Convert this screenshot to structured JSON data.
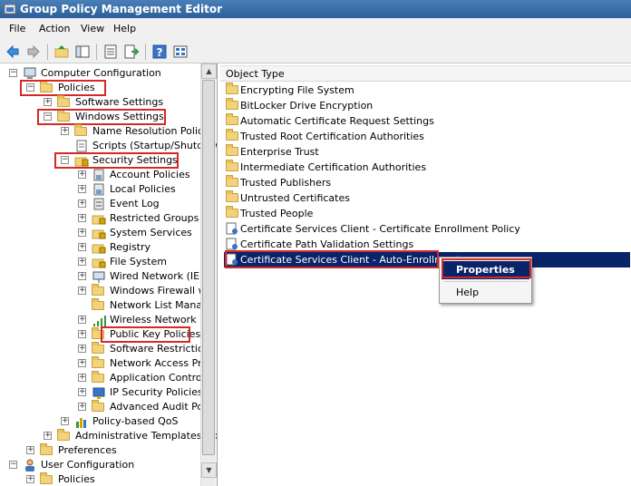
{
  "window": {
    "title": "Group Policy Management Editor"
  },
  "menu": {
    "file": "File",
    "action": "Action",
    "view": "View",
    "help": "Help"
  },
  "toolbar": {
    "icons": [
      "back-arrow-icon",
      "forward-arrow-icon",
      "up-folder-icon",
      "show-hide-tree-icon",
      "properties-icon",
      "export-list-icon",
      "help-icon",
      "view-icon"
    ]
  },
  "tree": {
    "computer_config": "Computer Configuration",
    "policies": "Policies",
    "software_settings": "Software Settings",
    "windows_settings": "Windows Settings",
    "name_resolution": "Name Resolution Policy",
    "scripts": "Scripts (Startup/Shutdow",
    "security_settings": "Security Settings",
    "account_policies": "Account Policies",
    "local_policies": "Local Policies",
    "event_log": "Event Log",
    "restricted_groups": "Restricted Groups",
    "system_services": "System Services",
    "registry": "Registry",
    "file_system": "File System",
    "wired_network": "Wired Network (IEEE",
    "windows_firewall": "Windows Firewall wit",
    "network_list": "Network List Manage",
    "wireless_network": "Wireless Network (IE",
    "public_key": "Public Key Policies",
    "software_restriction": "Software Restriction",
    "network_access": "Network Access Prot",
    "app_control": "Application Control P",
    "ip_security": "IP Security Policies o",
    "advanced_audit": "Advanced Audit Polic",
    "policy_qos": "Policy-based QoS",
    "admin_templates": "Administrative Templates: Pc",
    "preferences": "Preferences",
    "user_config": "User Configuration",
    "policies_partial": "Policies"
  },
  "list": {
    "column_header": "Object Type",
    "items": [
      "Encrypting File System",
      "BitLocker Drive Encryption",
      "Automatic Certificate Request Settings",
      "Trusted Root Certification Authorities",
      "Enterprise Trust",
      "Intermediate Certification Authorities",
      "Trusted Publishers",
      "Untrusted Certificates",
      "Trusted People",
      "Certificate Services Client - Certificate Enrollment Policy",
      "Certificate Path Validation Settings",
      "Certificate Services Client - Auto-Enrollment"
    ]
  },
  "context_menu": {
    "properties": "Properties",
    "help": "Help"
  },
  "colors": {
    "title_bar": "#2b5f98",
    "selection": "#0a246a",
    "highlight_box": "#d62828"
  }
}
